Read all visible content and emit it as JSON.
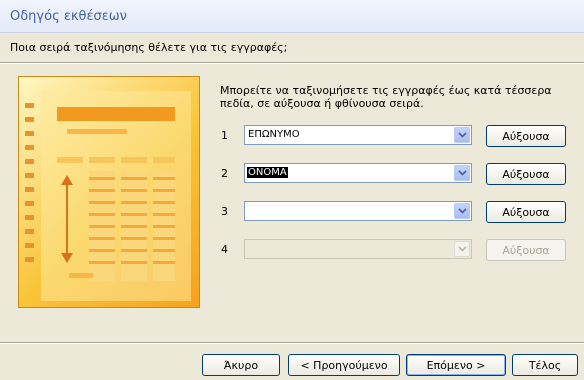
{
  "window": {
    "title": "Οδηγός εκθέσεων"
  },
  "prompt": {
    "question": "Ποια σειρά ταξινόμησης θέλετε για τις εγγραφές;"
  },
  "instructions": "Μπορείτε να ταξινομήσετε τις εγγραφές έως κατά τέσσερα πεδία, σε αύξουσα ή φθίνουσα σειρά.",
  "sort_rows": [
    {
      "number": "1",
      "field": "ΕΠΩΝΥΜΟ",
      "order": "Αύξουσα",
      "enabled": true
    },
    {
      "number": "2",
      "field": "ΟΝΟΜΑ",
      "order": "Αύξουσα",
      "enabled": true
    },
    {
      "number": "3",
      "field": "",
      "order": "Αύξουσα",
      "enabled": true
    },
    {
      "number": "4",
      "field": "",
      "order": "Αύξουσα",
      "enabled": false
    }
  ],
  "buttons": {
    "cancel": "Άκυρο",
    "back": "< Προηγούμενο",
    "next": "Επόμενο >",
    "finish": "Τέλος"
  },
  "colors": {
    "title_text": "#3f62a3",
    "accent": "#003c74",
    "illustration": "#f6a21e"
  },
  "illustration_icon": "report-sort-illustration"
}
